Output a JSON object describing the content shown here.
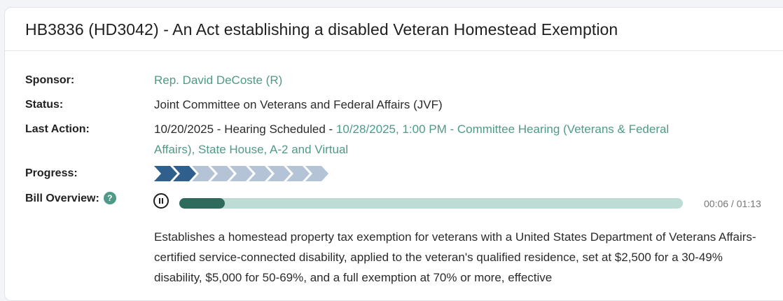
{
  "bill": {
    "title": "HB3836 (HD3042) - An Act establishing a disabled Veteran Homestead Exemption"
  },
  "labels": {
    "sponsor": "Sponsor:",
    "status": "Status:",
    "last_action": "Last Action:",
    "progress": "Progress:",
    "bill_overview": "Bill Overview:",
    "help_glyph": "?"
  },
  "sponsor": "Rep. David DeCoste (R)",
  "status": "Joint Committee on Veterans and Federal Affairs (JVF)",
  "last_action": {
    "prefix": "10/20/2025 - Hearing Scheduled - ",
    "link_line1": "10/28/2025, 1:00 PM - Committee Hearing (Veterans & Federal",
    "link_line2": "Affairs), State House, A-2 and Virtual"
  },
  "progress": {
    "total_steps": 9,
    "completed_steps": 2,
    "colors": {
      "done": "#2f5f8c",
      "todo": "#b4c4d6"
    }
  },
  "audio": {
    "icon": "pause-icon",
    "elapsed": "00:06",
    "duration": "01:13",
    "time_display": "00:06 / 01:13",
    "played_fraction": 0.09,
    "colors": {
      "played": "#2f6b5c",
      "remaining": "#bedcd6"
    }
  },
  "overview_text": "Establishes a homestead property tax exemption for veterans with a United States Department of Veterans Affairs-certified service-connected disability, applied to the veteran's qualified residence, set at $2,500 for a 30-49% disability, $5,000 for 50-69%, and a full exemption at 70% or more, effective",
  "colors": {
    "accent": "#4f9a86",
    "text": "#1f1f1f"
  }
}
